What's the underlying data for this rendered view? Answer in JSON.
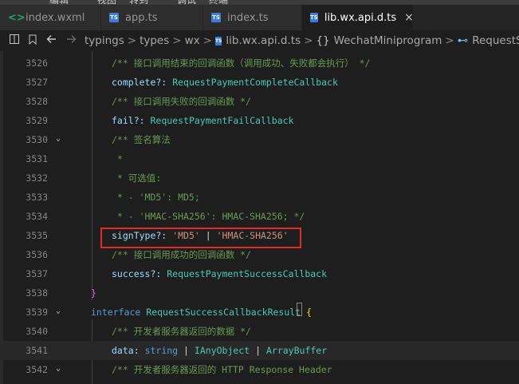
{
  "top_partial": [
    "编辑",
    "视图",
    "转到",
    "调试",
    "终端"
  ],
  "tabs": [
    {
      "icon": "wxml-icon",
      "label": "index.wxml",
      "active": false
    },
    {
      "icon": "ts-icon",
      "label": "app.ts",
      "active": false
    },
    {
      "icon": "ts-icon",
      "label": "index.ts",
      "active": false
    },
    {
      "icon": "ts-icon",
      "label": "lib.wx.api.d.ts",
      "active": true
    }
  ],
  "tab_icon_text": {
    "ts": "TS",
    "wxml": "<>"
  },
  "close_glyph": "×",
  "breadcrumb": {
    "items": [
      "typings",
      "types",
      "wx",
      "lib.wx.api.d.ts",
      "WechatMiniprogram",
      "RequestSu"
    ],
    "separator": ">",
    "namespace_symbol": "{}",
    "property_symbol": "⊷"
  },
  "lines": [
    {
      "n": "3526",
      "text": "/** 接口调用结束的回调函数（调用成功、失败都会执行） */"
    },
    {
      "n": "3527",
      "text": "complete?: RequestPaymentCompleteCallback"
    },
    {
      "n": "3528",
      "text": "/** 接口调用失败的回调函数 */"
    },
    {
      "n": "3529",
      "text": "fail?: RequestPaymentFailCallback"
    },
    {
      "n": "3530",
      "text": "/** 签名算法"
    },
    {
      "n": "3531",
      "text": " *"
    },
    {
      "n": "3532",
      "text": " * 可选值:"
    },
    {
      "n": "3533",
      "text": " * - 'MD5': MD5;"
    },
    {
      "n": "3534",
      "text": " * - 'HMAC-SHA256': HMAC-SHA256; */"
    },
    {
      "n": "3535",
      "text": "signType?: 'MD5' | 'HMAC-SHA256'"
    },
    {
      "n": "3536",
      "text": "/** 接口调用成功的回调函数 */"
    },
    {
      "n": "3537",
      "text": "success?: RequestPaymentSuccessCallback"
    },
    {
      "n": "3538",
      "text": "}"
    },
    {
      "n": "3539",
      "text": "interface RequestSuccessCallbackResult {"
    },
    {
      "n": "3540",
      "text": "/** 开发者服务器返回的数据 */"
    },
    {
      "n": "3541",
      "text": "data: string | IAnyObject | ArrayBuffer"
    },
    {
      "n": "3542",
      "text": "/** 开发者服务器返回的 HTTP Response Header"
    }
  ],
  "tokens": {
    "complete": "complete?:",
    "complete_type": "RequestPaymentCompleteCallback",
    "fail": "fail?:",
    "fail_type": "RequestPaymentFailCallback",
    "sign": "signType?:",
    "md5": "'MD5'",
    "pipe": "|",
    "hmac": "'HMAC-SHA256'",
    "success": "success?:",
    "success_type": "RequestPaymentSuccessCallback",
    "close_brace": "}",
    "interface_kw": "interface",
    "interface_name": "RequestSuccessCallbackResult",
    "open_brace": "{",
    "data": "data:",
    "string_kw": "string",
    "ianyobject": "IAnyObject",
    "arraybuffer": "ArrayBuffer"
  },
  "fold_lines": [
    "3530",
    "3539",
    "3542"
  ],
  "fold_glyph": "⌄",
  "current_line": "3541",
  "highlighted_line": "3535",
  "highlight_color": "#e02a2a"
}
